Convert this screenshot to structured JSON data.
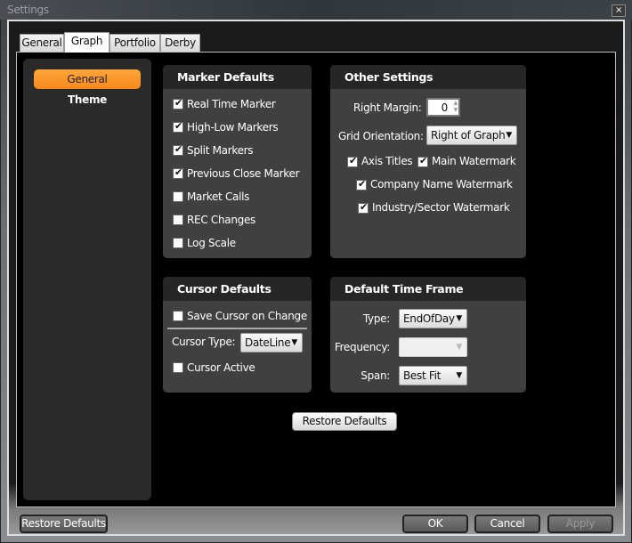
{
  "window": {
    "title": "Settings",
    "close_icon": "×"
  },
  "tabs": [
    {
      "label": "General"
    },
    {
      "label": "Graph",
      "selected": true
    },
    {
      "label": "Portfolio"
    },
    {
      "label": "Derby"
    }
  ],
  "sidebar": {
    "items": [
      {
        "label": "General",
        "selected": true
      },
      {
        "label": "Theme"
      }
    ]
  },
  "accent_color": "#f6891c",
  "marker_defaults": {
    "title": "Marker Defaults",
    "items": [
      {
        "label": "Real Time Marker",
        "checked": true
      },
      {
        "label": "High-Low Markers",
        "checked": true
      },
      {
        "label": "Split Markers",
        "checked": true
      },
      {
        "label": "Previous Close Marker",
        "checked": true
      },
      {
        "label": "Market Calls",
        "checked": false
      },
      {
        "label": "REC Changes",
        "checked": false
      },
      {
        "label": "Log Scale",
        "checked": false
      }
    ]
  },
  "other_settings": {
    "title": "Other Settings",
    "right_margin_label": "Right Margin:",
    "right_margin_value": "0",
    "grid_orientation_label": "Grid Orientation:",
    "grid_orientation_value": "Right of Graph",
    "axis_titles": {
      "label": "Axis Titles",
      "checked": true
    },
    "main_watermark": {
      "label": "Main Watermark",
      "checked": true
    },
    "company_watermark": {
      "label": "Company Name Watermark",
      "checked": true
    },
    "industry_watermark": {
      "label": "Industry/Sector Watermark",
      "checked": true
    }
  },
  "cursor_defaults": {
    "title": "Cursor Defaults",
    "save_cursor": {
      "label": "Save Cursor on Change",
      "checked": false
    },
    "cursor_type_label": "Cursor Type:",
    "cursor_type_value": "DateLine",
    "cursor_active": {
      "label": "Cursor Active",
      "checked": false
    }
  },
  "time_frame": {
    "title": "Default Time Frame",
    "type_label": "Type:",
    "type_value": "EndOfDay",
    "frequency_label": "Frequency:",
    "frequency_value": "",
    "span_label": "Span:",
    "span_value": "Best Fit"
  },
  "graph_restore_label": "Restore Defaults",
  "footer": {
    "restore_label": "Restore Defaults",
    "ok_label": "OK",
    "cancel_label": "Cancel",
    "apply_label": "Apply"
  }
}
